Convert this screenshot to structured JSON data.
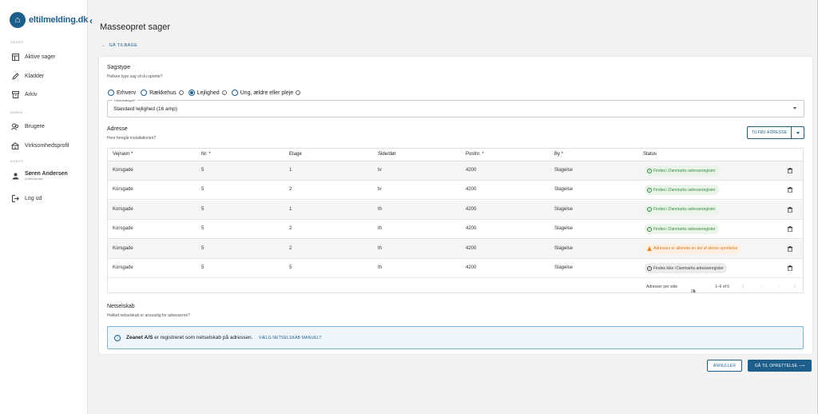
{
  "brand": {
    "logo_text": "eltilmelding.dk",
    "color": "#1d5f8a"
  },
  "sidebar": {
    "sections": [
      "SAGER",
      "ADMIN",
      "KONTO"
    ],
    "items": [
      {
        "label": "Aktive sager",
        "icon": "table-icon"
      },
      {
        "label": "Kladder",
        "icon": "pencil-icon"
      },
      {
        "label": "Arkiv",
        "icon": "archive-icon"
      },
      {
        "label": "Brugere",
        "icon": "users-icon"
      },
      {
        "label": "Virksomhedsprofil",
        "icon": "building-icon"
      }
    ],
    "user": {
      "name": "Søren Andersen",
      "role": "Administrator"
    },
    "logout": "Log ud"
  },
  "page": {
    "title": "Masseopret sager",
    "back": "GÅ TILBAGE"
  },
  "sagstype": {
    "heading": "Sagstype",
    "question": "Hvilken type sag vil du oprette?",
    "options": [
      "Erhverv",
      "Rækkehus",
      "Lejlighed",
      "Ung, ældre eller pleje"
    ],
    "selected": "Lejlighed",
    "subcategory_label": "Underkategori*",
    "subcategory_value": "Standard lejlighed (16 amp)"
  },
  "adresse": {
    "heading": "Adresse",
    "question": "Hvor foregår installationen?",
    "add_button": "TILFØJ ADRESSE",
    "columns": [
      "Vejnavn *",
      "Nr. *",
      "Etage",
      "Side/dør",
      "Postnr. *",
      "By *",
      "Status"
    ],
    "rows": [
      {
        "vej": "Korsgade",
        "nr": "5",
        "etage": "1",
        "side": "tv",
        "postnr": "4200",
        "by": "Slagelse",
        "status": "Findes i Danmarks adresseregister",
        "kind": "ok"
      },
      {
        "vej": "Korsgade",
        "nr": "5",
        "etage": "2",
        "side": "tv",
        "postnr": "4200",
        "by": "Slagelse",
        "status": "Findes i Danmarks adresseregister",
        "kind": "ok"
      },
      {
        "vej": "Korsgade",
        "nr": "5",
        "etage": "1",
        "side": "th",
        "postnr": "4200",
        "by": "Slagelse",
        "status": "Findes i Danmarks adresseregister",
        "kind": "ok"
      },
      {
        "vej": "Korsgade",
        "nr": "5",
        "etage": "2",
        "side": "th",
        "postnr": "4200",
        "by": "Slagelse",
        "status": "Findes i Danmarks adresseregister",
        "kind": "ok"
      },
      {
        "vej": "Korsgade",
        "nr": "5",
        "etage": "2",
        "side": "th",
        "postnr": "4200",
        "by": "Slagelse",
        "status": "Adressen er allerede en del af denne oprettelse",
        "kind": "warn"
      },
      {
        "vej": "Korsgade",
        "nr": "5",
        "etage": "5",
        "side": "th",
        "postnr": "4200",
        "by": "Slagelse",
        "status": "Findes ikke i Danmarks adresseregister",
        "kind": "na"
      }
    ],
    "pager": {
      "rows_label": "Adresser per side",
      "rows_value": "25",
      "range": "1–6 of 6"
    }
  },
  "netselskab": {
    "heading": "Netselskab",
    "question": "Hvilket netselskab er ansvarlig for adresserne?",
    "company": "Zeanet A/S",
    "info_text": "er registreret som netselskab på adressen.",
    "manual_link": "VÆLG NETSELSKAB MANUELT"
  },
  "actions": {
    "cancel": "ANNULLER",
    "next": "GÅ TIL OPRETTELSE ⟶"
  }
}
